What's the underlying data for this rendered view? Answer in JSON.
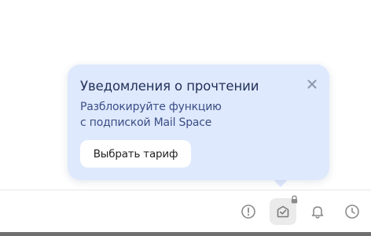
{
  "popover": {
    "title": "Уведомления о прочтении",
    "description_line1": "Разблокируйте функцию",
    "description_line2": "с подпиской Mail Space",
    "button_label": "Выбрать тариф",
    "close_icon": "close-icon",
    "background_color": "#dfe9fd"
  },
  "toolbar": {
    "icons": [
      "important-icon",
      "read-receipt-icon",
      "bell-icon",
      "clock-icon"
    ],
    "active_icon": "read-receipt-icon",
    "locked_icon": "lock-icon"
  }
}
